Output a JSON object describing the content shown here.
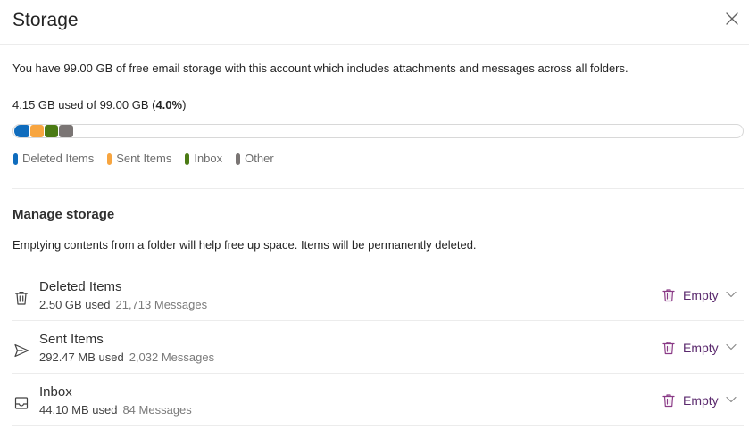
{
  "dialog": {
    "title": "Storage",
    "close_icon": "close-icon"
  },
  "summary": {
    "description": "You have 99.00 GB of free email storage with this account which includes attachments and messages across all folders.",
    "used_text": "4.15 GB used of 99.00 GB (",
    "used_percent": "4.0%",
    "used_suffix": ")",
    "used_fraction": 0.04
  },
  "legend": [
    {
      "label": "Deleted Items",
      "color": "#0f6cbd"
    },
    {
      "label": "Sent Items",
      "color": "#f7a540"
    },
    {
      "label": "Inbox",
      "color": "#4b7b14"
    },
    {
      "label": "Other",
      "color": "#7a7574"
    }
  ],
  "manage": {
    "title": "Manage storage",
    "description": "Emptying contents from a folder will help free up space. Items will be permanently deleted."
  },
  "folders": [
    {
      "name": "Deleted Items",
      "size": "2.50 GB used",
      "count": "21,713 Messages",
      "icon": "trash-icon",
      "action": "Empty"
    },
    {
      "name": "Sent Items",
      "size": "292.47 MB used",
      "count": "2,032 Messages",
      "icon": "send-icon",
      "action": "Empty"
    },
    {
      "name": "Inbox",
      "size": "44.10 MB used",
      "count": "84 Messages",
      "icon": "inbox-icon",
      "action": "Empty"
    }
  ],
  "colors": {
    "accent": "#5b2a6e",
    "divider": "#ececec"
  }
}
